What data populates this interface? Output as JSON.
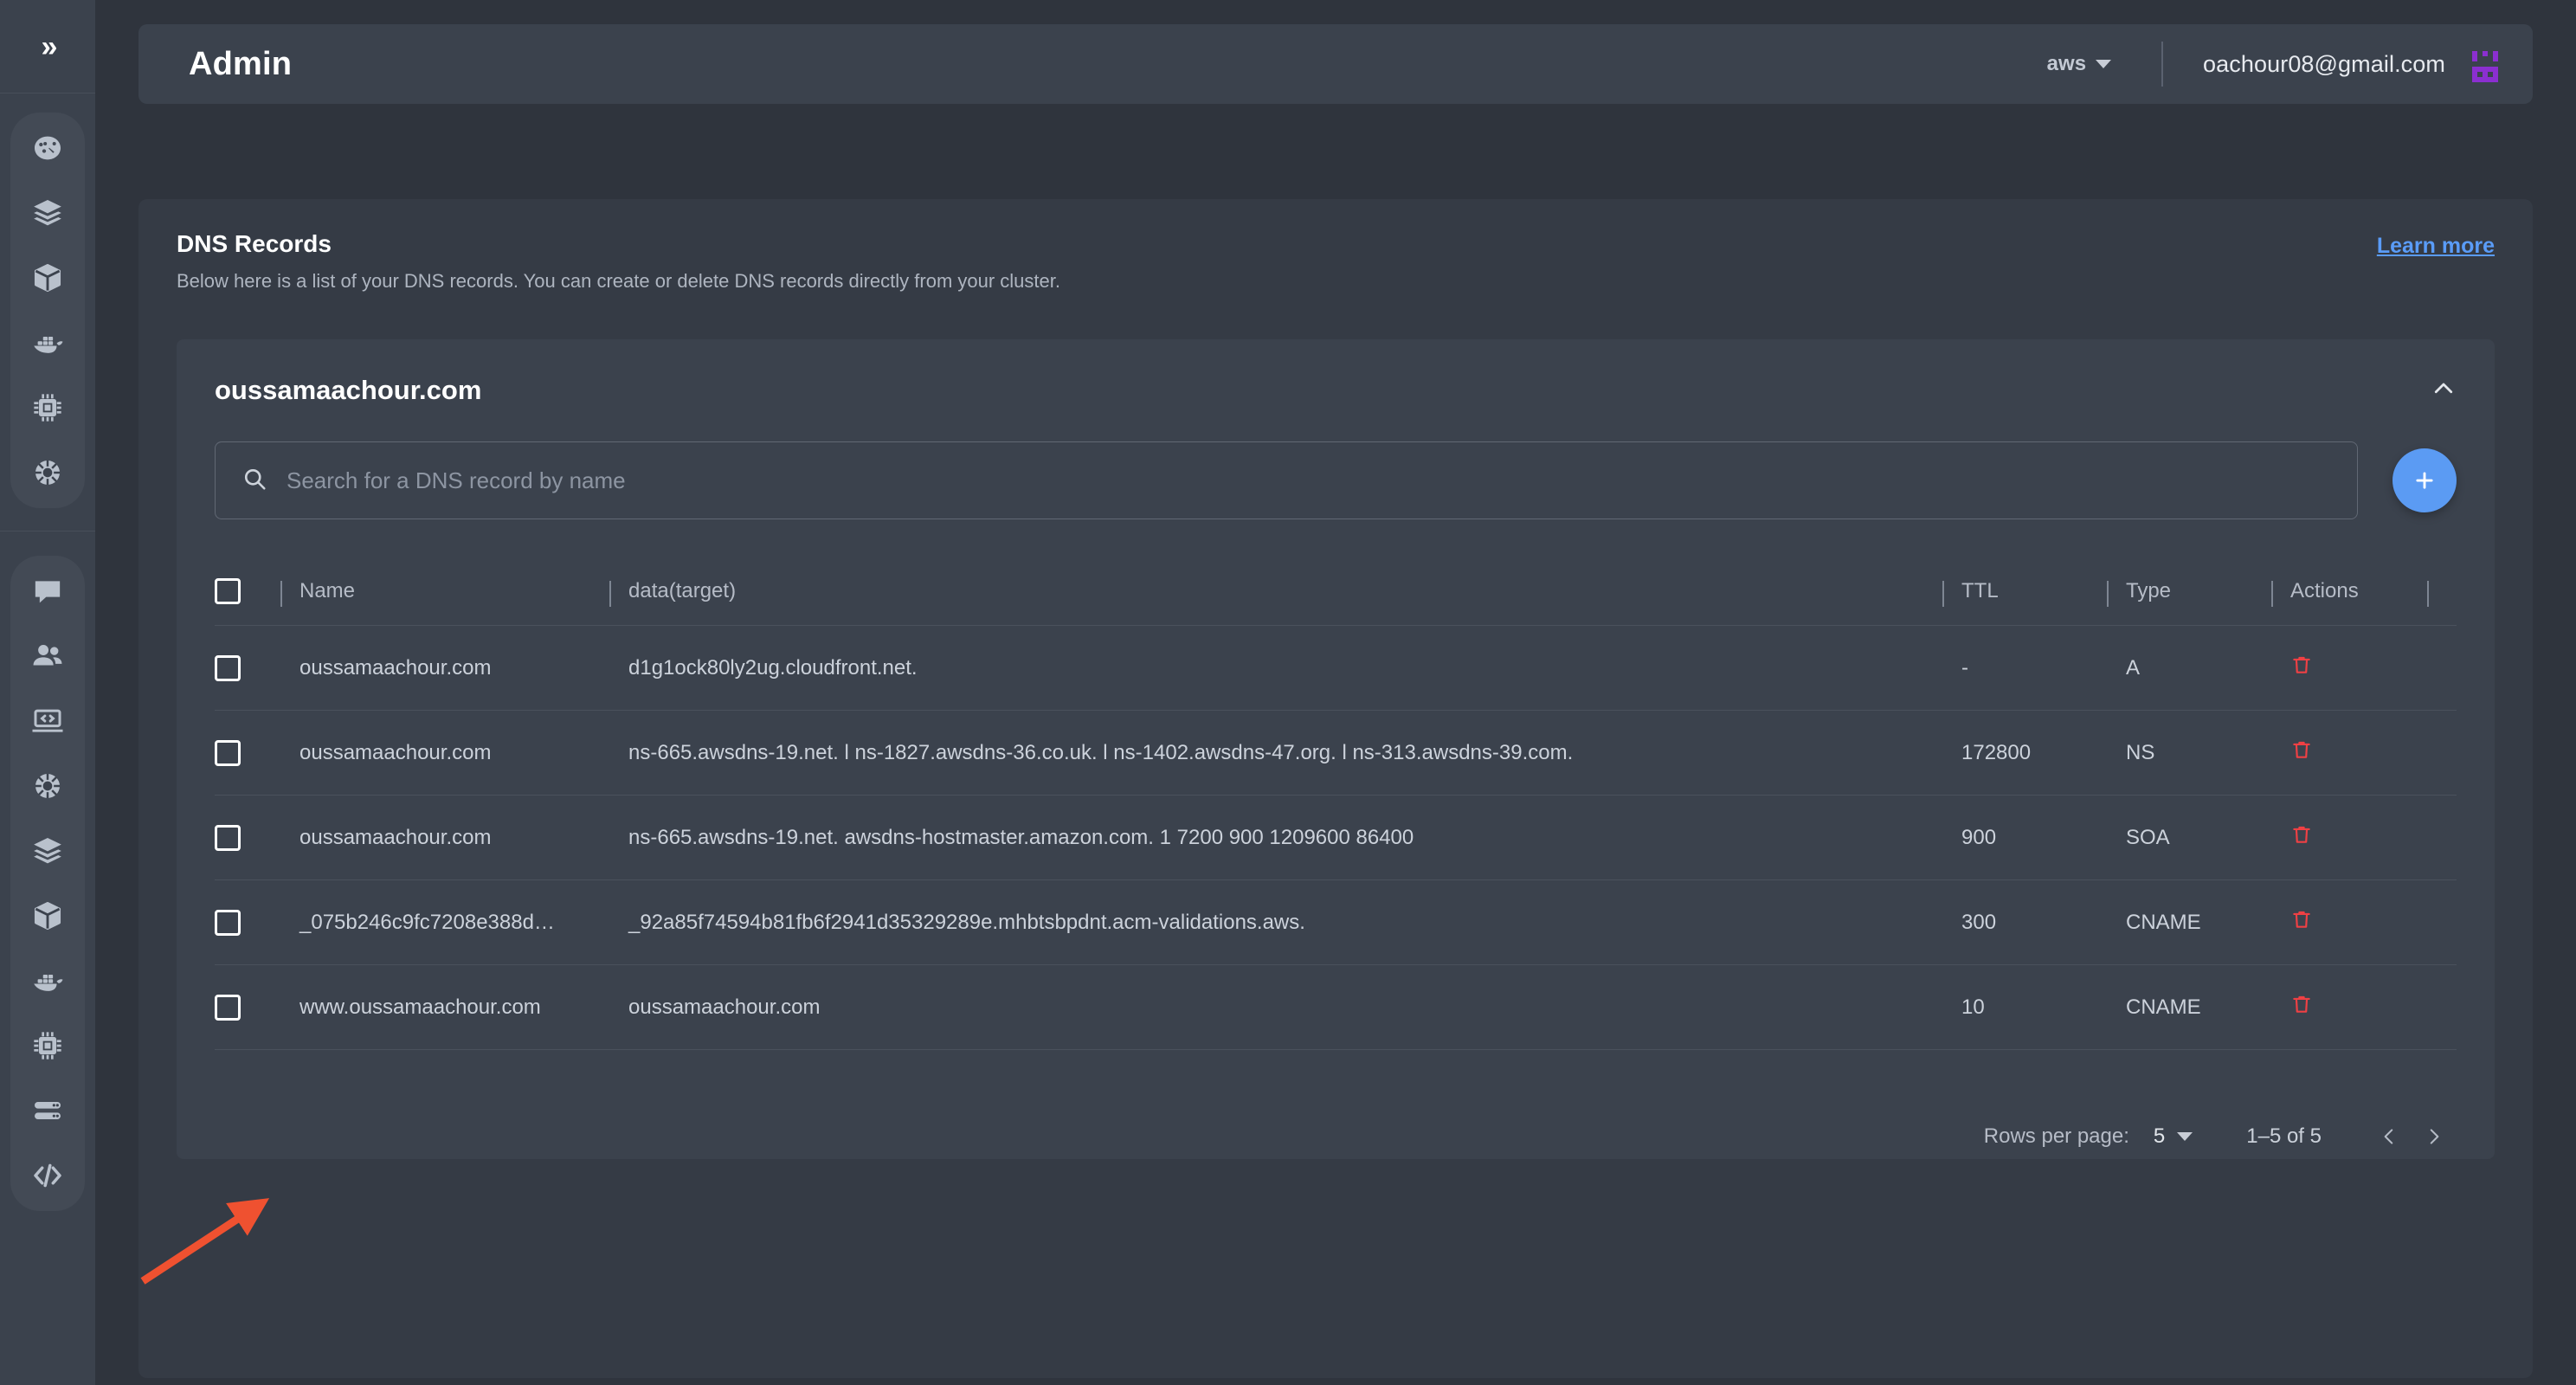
{
  "sidebar": {
    "collapse_label": "»",
    "group1": [
      {
        "icon": "gauge-icon",
        "name": "dashboard"
      },
      {
        "icon": "layers-icon",
        "name": "stacks"
      },
      {
        "icon": "cube-icon",
        "name": "containers"
      },
      {
        "icon": "docker-whale-icon",
        "name": "docker"
      },
      {
        "icon": "cpu-chip-icon",
        "name": "compute"
      },
      {
        "icon": "kubernetes-helm-icon",
        "name": "kubernetes"
      }
    ],
    "group2": [
      {
        "icon": "chat-bubble-icon",
        "name": "messages"
      },
      {
        "icon": "users-icon",
        "name": "teams"
      },
      {
        "icon": "laptop-code-icon",
        "name": "develop"
      },
      {
        "icon": "kubernetes-helm-icon",
        "name": "clusters"
      },
      {
        "icon": "layers-icon",
        "name": "layers"
      },
      {
        "icon": "cube-icon",
        "name": "packages"
      },
      {
        "icon": "docker-whale-icon",
        "name": "images"
      },
      {
        "icon": "cpu-chip-icon",
        "name": "nodes"
      },
      {
        "icon": "server-rack-icon",
        "name": "servers"
      },
      {
        "icon": "code-brackets-icon",
        "name": "code"
      }
    ]
  },
  "topbar": {
    "title": "Admin",
    "provider": "aws",
    "user_email": "oachour08@gmail.com",
    "avatar_color": "#8b2fd0"
  },
  "card": {
    "title": "DNS Records",
    "subtitle": "Below here is a list of your DNS records. You can create or delete DNS records directly from your cluster.",
    "learn_more": "Learn more",
    "learn_more_color": "#5a9cf8"
  },
  "accordion": {
    "domain": "oussamaachour.com",
    "expanded": true
  },
  "search": {
    "placeholder": "Search for a DNS record by name",
    "value": ""
  },
  "add_button": {
    "label": "+",
    "color": "#5b9bf3"
  },
  "table": {
    "columns": [
      "Name",
      "data(target)",
      "TTL",
      "Type",
      "Actions"
    ],
    "rows": [
      {
        "name": "oussamaachour.com",
        "data": "d1g1ock80ly2ug.cloudfront.net.",
        "ttl": "-",
        "type": "A",
        "action": "delete-icon",
        "checked": false
      },
      {
        "name": "oussamaachour.com",
        "data": "ns-665.awsdns-19.net. l ns-1827.awsdns-36.co.uk. l ns-1402.awsdns-47.org. l ns-313.awsdns-39.com.",
        "ttl": "172800",
        "type": "NS",
        "action": "delete-icon",
        "checked": false
      },
      {
        "name": "oussamaachour.com",
        "data": "ns-665.awsdns-19.net. awsdns-hostmaster.amazon.com. 1 7200 900 1209600 86400",
        "ttl": "900",
        "type": "SOA",
        "action": "delete-icon",
        "checked": false
      },
      {
        "name": "_075b246c9fc7208e388d…",
        "data": "_92a85f74594b81fb6f2941d35329289e.mhbtsbpdnt.acm-validations.aws.",
        "ttl": "300",
        "type": "CNAME",
        "action": "delete-icon",
        "checked": false
      },
      {
        "name": "www.oussamaachour.com",
        "data": "oussamaachour.com",
        "ttl": "10",
        "type": "CNAME",
        "action": "delete-icon",
        "checked": false
      }
    ],
    "delete_icon_color": "#ef4044"
  },
  "pagination": {
    "rows_per_page_label": "Rows per page:",
    "rows_per_page_value": "5",
    "range": "1–5 of 5",
    "prev": "‹",
    "next": "›"
  },
  "annotation": {
    "type": "arrow",
    "color": "#ef5130",
    "points_to": "row-5-checkbox"
  }
}
